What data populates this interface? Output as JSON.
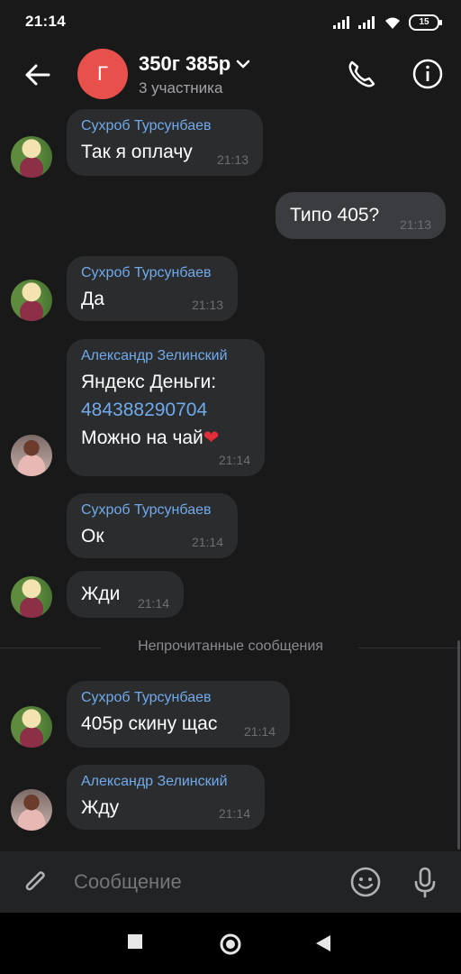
{
  "status_bar": {
    "time": "21:14",
    "battery": "15"
  },
  "header": {
    "title": "350г 385р",
    "subtitle": "3 участника",
    "avatar_letter": "Г",
    "avatar_color": "#e8504b"
  },
  "messages": [
    {
      "sender": "Сухроб Турсунбаев",
      "text": "Так я оплачу",
      "time": "21:13"
    },
    {
      "text": "Типо 405?",
      "time": "21:13",
      "outgoing": true
    },
    {
      "sender": "Сухроб Турсунбаев",
      "text": "Да",
      "time": "21:13"
    },
    {
      "sender": "Александр Зелинский",
      "text_line1": "Яндекс Деньги:",
      "link": "484388290704",
      "text_line3": "Можно на чай",
      "emoji": "❤",
      "time": "21:14"
    },
    {
      "sender": "Сухроб Турсунбаев",
      "text": "Ок",
      "time": "21:14"
    },
    {
      "text": "Жди",
      "time": "21:14"
    },
    {
      "sender": "Сухроб Турсунбаев",
      "text": "405р скину щас",
      "time": "21:14"
    },
    {
      "sender": "Александр Зелинский",
      "text": "Жду",
      "time": "21:14"
    }
  ],
  "divider": {
    "label": "Непрочитанные сообщения"
  },
  "composer": {
    "placeholder": "Сообщение"
  },
  "colors": {
    "background": "#19191a",
    "bubble": "#2b2c2e",
    "accent": "#71aaeb"
  },
  "icons": [
    "back-arrow-icon",
    "phone-icon",
    "info-icon",
    "attach-icon",
    "emoji-icon",
    "mic-icon",
    "nav-recents-icon",
    "nav-home-icon",
    "nav-back-icon"
  ]
}
